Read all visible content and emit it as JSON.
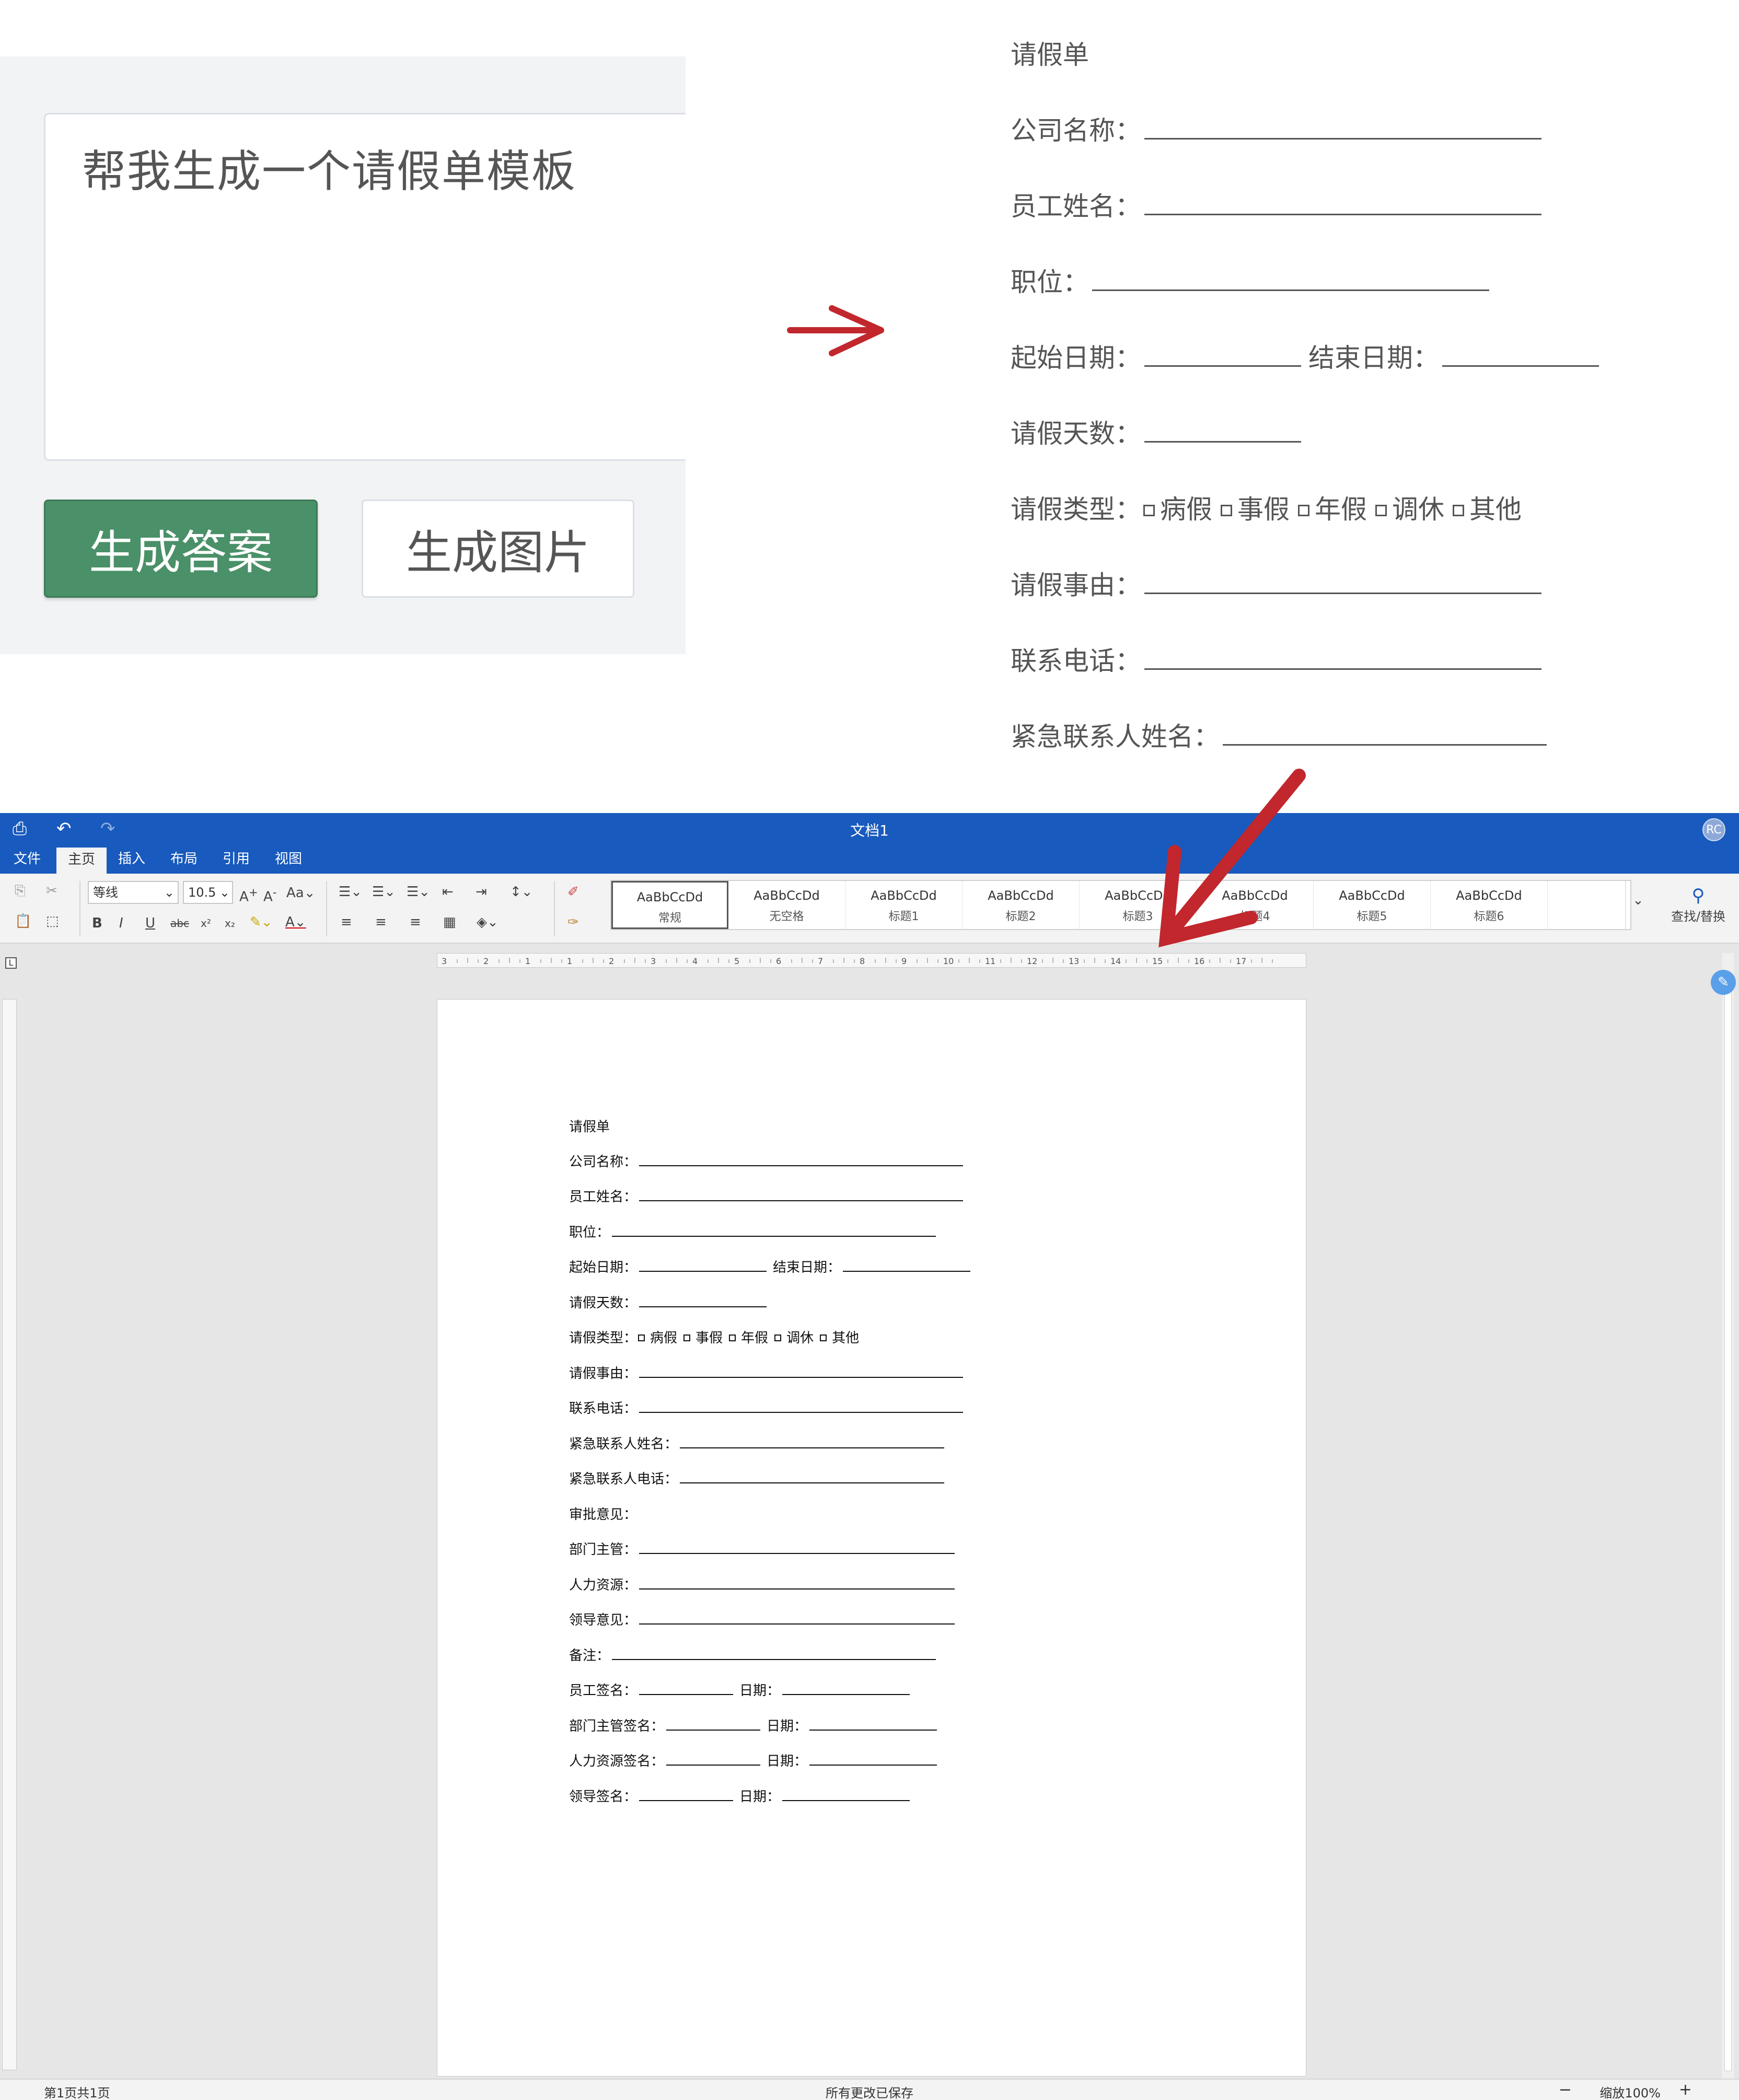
{
  "chat": {
    "prompt": "帮我生成一个请假单模板",
    "generate_button": "生成答案",
    "image_button": "生成图片"
  },
  "preview": {
    "title": "请假单",
    "company": "公司名称：",
    "employee": "员工姓名：",
    "position": "职位：",
    "start_date": "起始日期：",
    "end_date": "结束日期：",
    "days": "请假天数：",
    "type": "请假类型：",
    "type_options": [
      "病假",
      "事假",
      "年假",
      "调休",
      "其他"
    ],
    "reason": "请假事由：",
    "phone": "联系电话：",
    "emergency_name": "紧急联系人姓名："
  },
  "editor": {
    "title": "文档1",
    "avatar": "RC",
    "menu": [
      "文件",
      "主页",
      "插入",
      "布局",
      "引用",
      "视图"
    ],
    "font_name": "等线",
    "font_size": "10.5",
    "styles": [
      {
        "sample": "AaBbCcDd",
        "name": "常规"
      },
      {
        "sample": "AaBbCcDd",
        "name": "无空格"
      },
      {
        "sample": "AaBbCcDd",
        "name": "标题1"
      },
      {
        "sample": "AaBbCcDd",
        "name": "标题2"
      },
      {
        "sample": "AaBbCcDd",
        "name": "标题3"
      },
      {
        "sample": "AaBbCcDd",
        "name": "标题4"
      },
      {
        "sample": "AaBbCcDd",
        "name": "标题5"
      },
      {
        "sample": "AaBbCcDd",
        "name": "标题6"
      }
    ],
    "find_replace": "查找/替换",
    "ruler_marks": [
      "3",
      "2",
      "1",
      "1",
      "2",
      "3",
      "4",
      "5",
      "6",
      "7",
      "8",
      "9",
      "10",
      "11",
      "12",
      "13",
      "14",
      "15",
      "16",
      "17"
    ],
    "status_page": "第1页共1页",
    "status_saved": "所有更改已保存",
    "status_zoom": "缩放100%",
    "accent_color": "#185abd"
  },
  "document": {
    "title": "请假单",
    "company": "公司名称：",
    "employee": "员工姓名：",
    "position": "职位：",
    "start_date": "起始日期：",
    "end_date": "结束日期：",
    "days": "请假天数：",
    "type": "请假类型：",
    "type_options": [
      "病假",
      "事假",
      "年假",
      "调休",
      "其他"
    ],
    "reason": "请假事由：",
    "phone": "联系电话：",
    "emergency_name": "紧急联系人姓名：",
    "emergency_phone": "紧急联系人电话：",
    "approval": "审批意见：",
    "dept_manager": "部门主管：",
    "hr": "人力资源：",
    "leader_opinion": "领导意见：",
    "notes": "备注：",
    "employee_sign": "员工签名：",
    "manager_sign": "部门主管签名：",
    "hr_sign": "人力资源签名：",
    "leader_sign": "领导签名：",
    "date": "日期："
  }
}
